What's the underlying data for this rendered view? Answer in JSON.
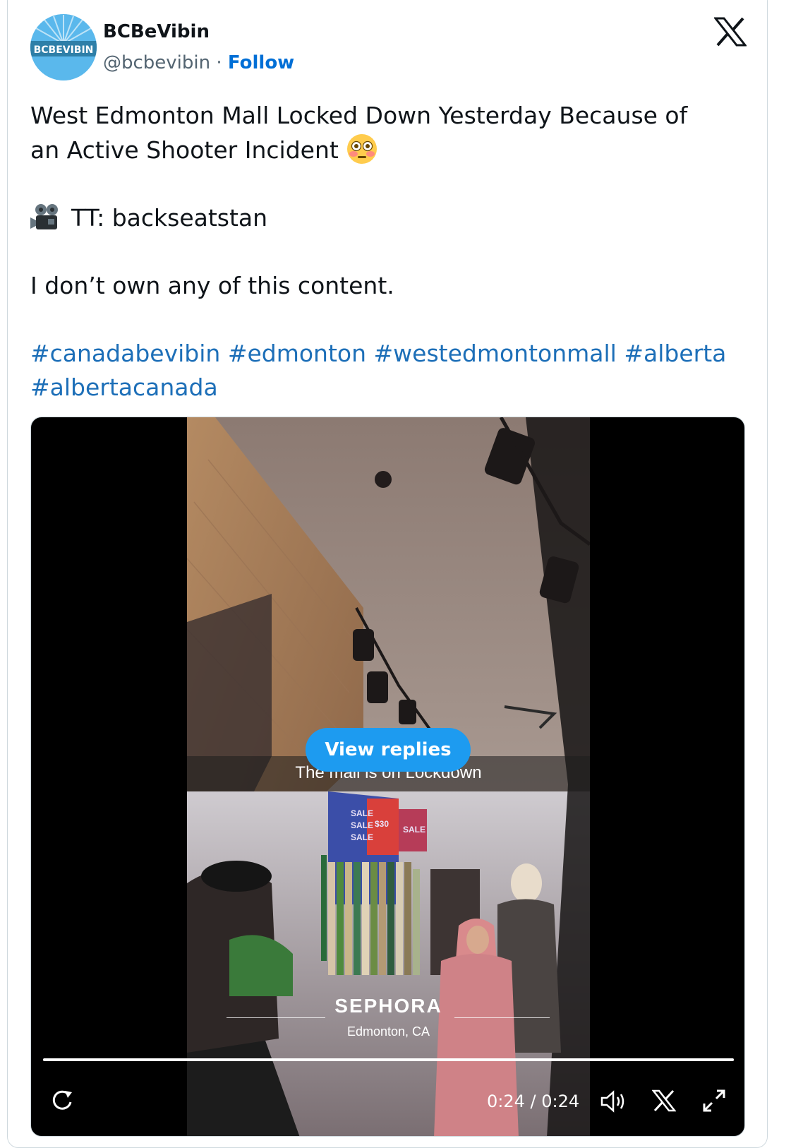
{
  "author": {
    "avatar_text": "BCBEVIBIN",
    "name": "BCBeVibin",
    "handle": "@bcbevibin",
    "separator": "·",
    "follow_label": "Follow"
  },
  "tweet": {
    "line1": "West Edmonton Mall Locked Down Yesterday Because of",
    "line2": "an Active Shooter Incident",
    "credit": "TT: backseatstan",
    "disclaimer": "I don’t own any of this content.",
    "hashtags": [
      "#canadabevibin",
      "#edmonton",
      "#westedmontonmall",
      "#alberta",
      "#albertacanada"
    ]
  },
  "video": {
    "caption": "The mall is on Lockdown",
    "view_replies_label": "View replies",
    "location_title": "SEPHORA",
    "location_sub": "Edmonton, CA",
    "store_signs": [
      "SALE",
      "SALE",
      "SALE",
      "$30",
      "SALE"
    ],
    "time": "0:24 / 0:24",
    "progress_fraction": 1.0
  },
  "icons": {
    "brand": "x-logo",
    "emoji": "flushed-face-emoji",
    "camera": "movie-camera-emoji",
    "controls": [
      "replay-icon",
      "volume-icon",
      "x-logo-icon",
      "expand-icon"
    ]
  },
  "colors": {
    "link": "#1d6fb8",
    "follow": "#006fd6",
    "view_replies_bg": "#1d9bf0",
    "avatar_bg": "#5ab8ec"
  }
}
